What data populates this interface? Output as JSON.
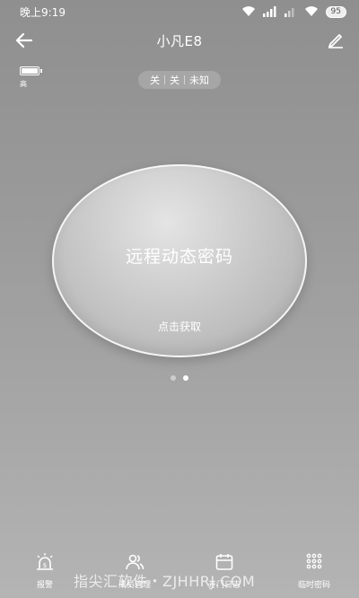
{
  "status_bar": {
    "time": "晚上9:19",
    "battery": "95"
  },
  "header": {
    "title": "小凡E8"
  },
  "lock_battery": {
    "label": "高",
    "level": 1.0
  },
  "status_chips": [
    "关",
    "关",
    "未知"
  ],
  "main_card": {
    "title": "远程动态密码",
    "action": "点击获取"
  },
  "pager": {
    "total": 2,
    "active_index": 1
  },
  "bottom_nav": [
    {
      "label": "报警",
      "icon": "alarm-icon"
    },
    {
      "label": "成员管理",
      "icon": "members-icon"
    },
    {
      "label": "开门日志",
      "icon": "calendar-icon"
    },
    {
      "label": "临时密码",
      "icon": "keypad-icon"
    }
  ],
  "watermark": "指尖汇软件・ZJHHRJ.COM"
}
